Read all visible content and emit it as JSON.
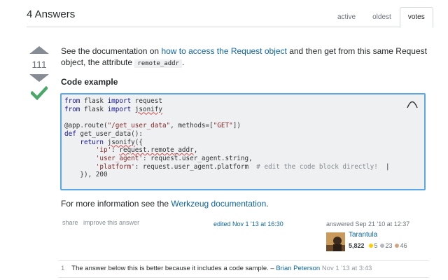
{
  "header": {
    "answers_title": "4 Answers",
    "tabs": [
      {
        "label": "active",
        "selected": false
      },
      {
        "label": "oldest",
        "selected": false
      },
      {
        "label": "votes",
        "selected": true
      }
    ]
  },
  "answer": {
    "vote_count": "111",
    "accepted": true,
    "intro": {
      "text_before": "See the documentation on ",
      "link_text": "how to access the Request object",
      "text_middle": " and then get from this same Request object, the attribute ",
      "inline_code": "remote_addr",
      "text_after": "."
    },
    "code_heading": "Code example",
    "code_lines": [
      "from flask import request",
      "from flask import jsonify",
      "",
      "@app.route(\"/get_user_data\", methods=[\"GET\"])",
      "def get_user_data():",
      "    return jsonify({",
      "        'ip': request.remote_addr,",
      "        'user_agent': request.user_agent.string,",
      "        'platform': request.user_agent.platform  # edit the code block directly!  |",
      "    }), 200"
    ],
    "more_info": {
      "text_before": "For more information see the ",
      "link_text": "Werkzeug documentation",
      "text_after": "."
    },
    "menu": {
      "share": "share",
      "improve": "improve this answer"
    },
    "edited": "edited Nov 1 '13 at 16:30",
    "answered": "answered Sep 21 '10 at 12:37",
    "user": {
      "name": "Tarantula",
      "reputation": "5,822",
      "gold": "5",
      "silver": "23",
      "bronze": "46"
    }
  },
  "comment": {
    "score": "1",
    "text": "The answer below this is better because it includes a code sample. – ",
    "user": "Brian Peterson",
    "date": "Nov 1 '13 at 3:43"
  },
  "colors": {
    "link": "#0c65a5",
    "accepted_check": "#48a868",
    "code_border": "#5aa9e6",
    "gold": "#ffcc01",
    "silver": "#b4b8bc",
    "bronze": "#d1a684"
  }
}
